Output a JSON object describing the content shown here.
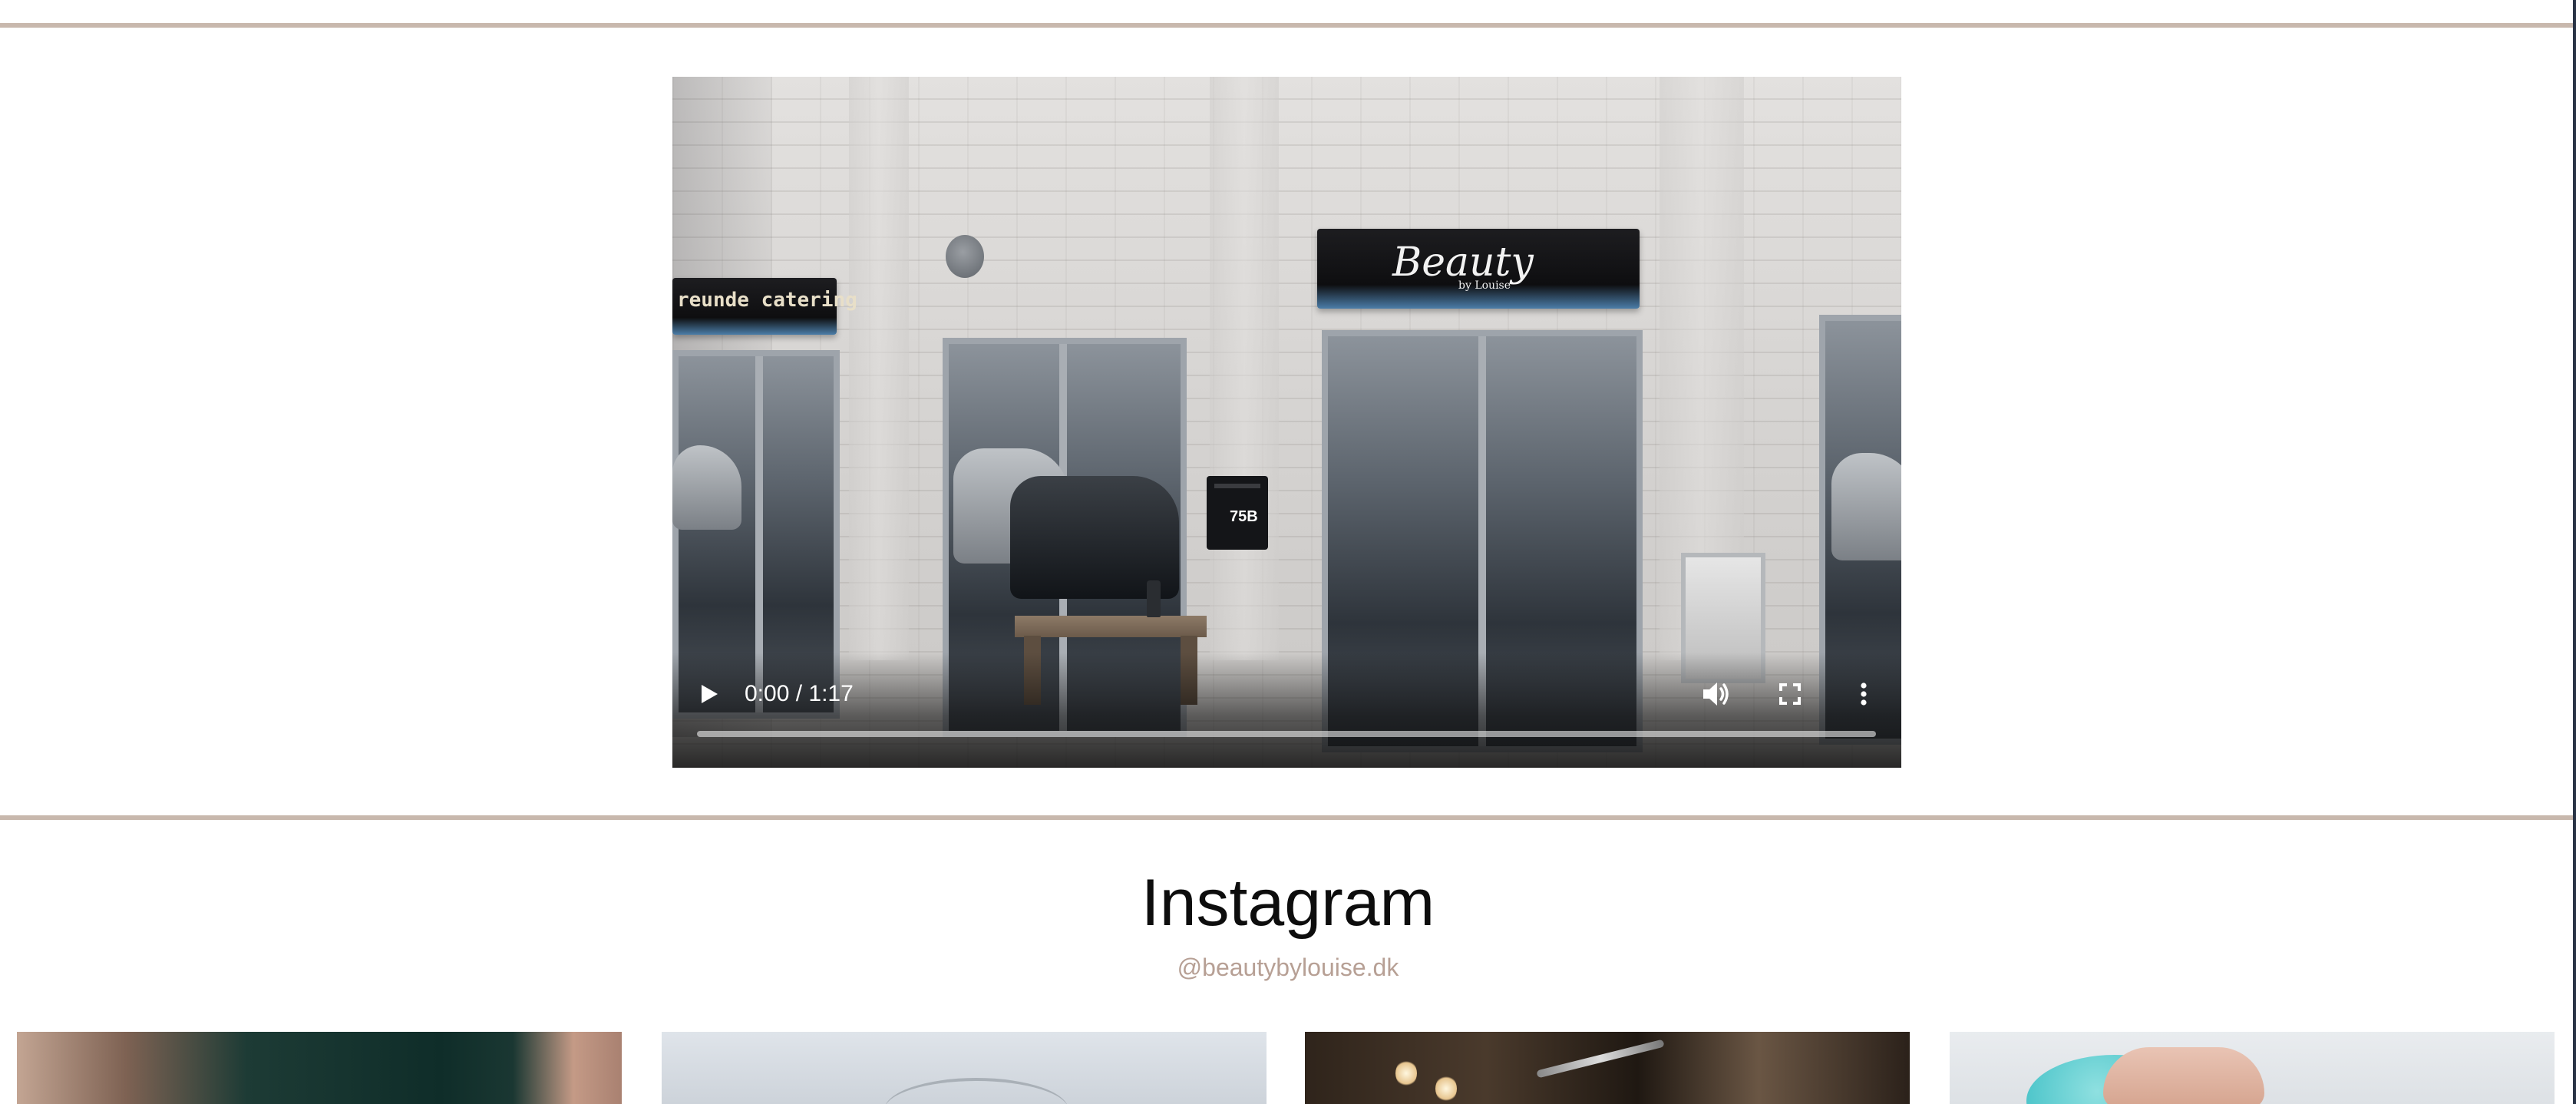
{
  "video": {
    "time_display": "0:00 / 1:17",
    "progress": 0,
    "controls": {
      "play_icon": "play-icon",
      "volume_icon": "volume-icon",
      "fullscreen_icon": "fullscreen-icon",
      "more_icon": "more-options-icon"
    },
    "scene": {
      "storefront_sign": "Beauty",
      "storefront_sign_sub": "by Louise",
      "neighbor_sign": "reunde catering",
      "mailbox_number": "75B"
    }
  },
  "instagram": {
    "title": "Instagram",
    "handle": "@beautybylouise.dk",
    "posts": [
      {
        "name": "instagram-post-1"
      },
      {
        "name": "instagram-post-2"
      },
      {
        "name": "instagram-post-3"
      },
      {
        "name": "instagram-post-4"
      }
    ]
  },
  "colors": {
    "divider": "#c8b8ad",
    "handle_text": "#b7a095",
    "title_text": "#0d0d0d"
  }
}
